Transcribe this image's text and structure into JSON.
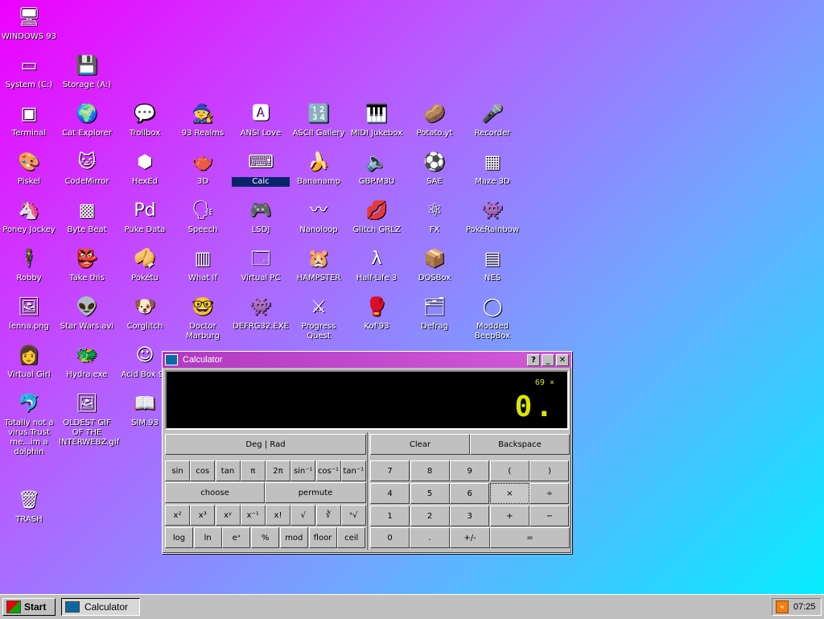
{
  "desktop": {
    "icons": [
      {
        "label": "WINDOWS 93",
        "glyph": "🖥",
        "icon": "computer-icon"
      },
      {
        "label": "System (C:)",
        "glyph": "▭",
        "icon": "drive-icon"
      },
      {
        "label": "Storage (A:)",
        "glyph": "💾",
        "icon": "floppy-icon"
      },
      {
        "label": "Terminal",
        "glyph": "▣",
        "icon": "terminal-icon"
      },
      {
        "label": "Cat Explorer",
        "glyph": "🌍",
        "icon": "cat-explorer-icon"
      },
      {
        "label": "Trollbox",
        "glyph": "💬",
        "icon": "trollbox-icon"
      },
      {
        "label": "93 Realms",
        "glyph": "🧙",
        "icon": "realms-icon"
      },
      {
        "label": "ANSI Love",
        "glyph": "🅰",
        "icon": "ansi-icon"
      },
      {
        "label": "ASCII Gallery",
        "glyph": "🔢",
        "icon": "ascii-icon"
      },
      {
        "label": "MIDI Jukebox",
        "glyph": "🎹",
        "icon": "midi-icon"
      },
      {
        "label": "Potato.yt",
        "glyph": "🥔",
        "icon": "potato-icon"
      },
      {
        "label": "Recorder",
        "glyph": "🎤",
        "icon": "microphone-icon"
      },
      {
        "label": "Piskel",
        "glyph": "🎨",
        "icon": "palette-icon"
      },
      {
        "label": "CodeMirror",
        "glyph": "🐱",
        "icon": "codemirror-icon"
      },
      {
        "label": "HexEd",
        "glyph": "⬢",
        "icon": "cube-icon"
      },
      {
        "label": "3D",
        "glyph": "🫖",
        "icon": "teapot-icon"
      },
      {
        "label": "Calc",
        "glyph": "⌨",
        "icon": "calculator-icon"
      },
      {
        "label": "Bananamp",
        "glyph": "🍌",
        "icon": "banana-icon"
      },
      {
        "label": "GBP.M3U",
        "glyph": "🔈",
        "icon": "speaker-icon"
      },
      {
        "label": "SAE",
        "glyph": "⚽",
        "icon": "ball-icon"
      },
      {
        "label": "Maze 3D",
        "glyph": "▦",
        "icon": "maze-icon"
      },
      {
        "label": "Poney Jockey",
        "glyph": "🦄",
        "icon": "pony-icon"
      },
      {
        "label": "Byte Beat",
        "glyph": "▩",
        "icon": "bytebeat-icon"
      },
      {
        "label": "Puke Data",
        "glyph": "Pd",
        "icon": "pd-icon"
      },
      {
        "label": "Speech",
        "glyph": "🗣",
        "icon": "speech-icon"
      },
      {
        "label": "LSDJ",
        "glyph": "🎮",
        "icon": "lsdj-icon"
      },
      {
        "label": "Nanoloop",
        "glyph": "〰",
        "icon": "wave-icon"
      },
      {
        "label": "Glitch GRLZ",
        "glyph": "💋",
        "icon": "lips-icon"
      },
      {
        "label": "FX",
        "glyph": "⚛",
        "icon": "atom-icon"
      },
      {
        "label": "PokéRainbow",
        "glyph": "👾",
        "icon": "pokerainbow-icon"
      },
      {
        "label": "Robby",
        "glyph": "🕴",
        "icon": "robby-icon"
      },
      {
        "label": "Take this",
        "glyph": "👺",
        "icon": "take-this-icon"
      },
      {
        "label": "Pokétu",
        "glyph": "🥠",
        "icon": "poketu-icon"
      },
      {
        "label": "What If",
        "glyph": "▥",
        "icon": "whatif-icon"
      },
      {
        "label": "Virtual PC",
        "glyph": "🗔",
        "icon": "virtual-pc-icon"
      },
      {
        "label": "HAMPSTER",
        "glyph": "🐹",
        "icon": "hamster-icon"
      },
      {
        "label": "Half-Life 3",
        "glyph": "λ",
        "icon": "lambda-icon"
      },
      {
        "label": "DOSBox",
        "glyph": "📦",
        "icon": "dosbox-icon"
      },
      {
        "label": "NES",
        "glyph": "▤",
        "icon": "nes-icon"
      },
      {
        "label": "lenna.png",
        "glyph": "🖼",
        "icon": "image-file-icon"
      },
      {
        "label": "Star Wars.avi",
        "glyph": "👽",
        "icon": "yoda-icon"
      },
      {
        "label": "Corglitch",
        "glyph": "🐶",
        "icon": "corgi-icon"
      },
      {
        "label": "Doctor Marburg",
        "glyph": "🤓",
        "icon": "doctor-icon"
      },
      {
        "label": "DEFRG32.EXE",
        "glyph": "👾",
        "icon": "defrg-icon"
      },
      {
        "label": "Progress Quest",
        "glyph": "⚔",
        "icon": "swords-icon"
      },
      {
        "label": "Kof'93",
        "glyph": "🥊",
        "icon": "fighter-icon"
      },
      {
        "label": "Defrag",
        "glyph": "🗂",
        "icon": "defrag-icon"
      },
      {
        "label": "Modded BeepBox",
        "glyph": "◯",
        "icon": "beepbox-icon"
      },
      {
        "label": "Virtual Girl",
        "glyph": "👩",
        "icon": "virtual-girl-icon"
      },
      {
        "label": "Hydra.exe",
        "glyph": "🐲",
        "icon": "hydra-icon"
      },
      {
        "label": "Acid Box 93",
        "glyph": "☺",
        "icon": "smiley-icon"
      },
      {
        "label": "Totally not a virus.Trust me...im a dolphin",
        "glyph": "🐬",
        "icon": "dolphin-icon"
      },
      {
        "label": "OLDEST GIF OF THE INTERWEBZ.gif",
        "glyph": "🖼",
        "icon": "gif-file-icon"
      },
      {
        "label": "SIM.93",
        "glyph": "📖",
        "icon": "book-icon"
      },
      {
        "label": "TRASH",
        "glyph": "🗑",
        "icon": "trash-icon"
      }
    ]
  },
  "calculator": {
    "title": "Calculator",
    "help_glyph": "?",
    "minimize_glyph": "_",
    "close_glyph": "✕",
    "memory": "69 ×",
    "display": "0.",
    "deg_rad": "Deg | Rad",
    "clear": "Clear",
    "backspace": "Backspace",
    "sci_row1": [
      "sin",
      "cos",
      "tan",
      "π",
      "2π",
      "sin⁻¹",
      "cos⁻¹",
      "tan⁻¹"
    ],
    "choose": "choose",
    "permute": "permute",
    "sci_row3": [
      "x²",
      "x³",
      "xʸ",
      "x⁻¹",
      "x!",
      "√",
      "∛",
      "ˣ√"
    ],
    "sci_row4": [
      "log",
      "ln",
      "eˣ",
      "%",
      "mod",
      "floor",
      "ceil"
    ],
    "num_rows": [
      [
        "7",
        "8",
        "9",
        "(",
        ")"
      ],
      [
        "4",
        "5",
        "6",
        "×",
        "÷"
      ],
      [
        "1",
        "2",
        "3",
        "+",
        "−"
      ]
    ],
    "last_row": [
      "0",
      ".",
      "+/-",
      "="
    ]
  },
  "taskbar": {
    "start": "Start",
    "task": "Calculator",
    "clock": "07:25",
    "rss_glyph": "≈"
  }
}
